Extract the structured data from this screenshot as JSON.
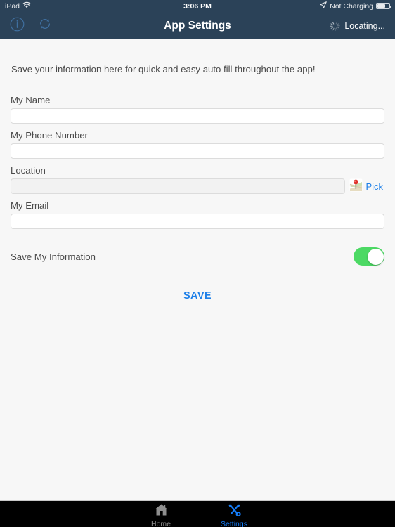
{
  "status_bar": {
    "device": "iPad",
    "wifi_icon": "wifi-icon",
    "time": "3:06 PM",
    "location_arrow_icon": "location-arrow-icon",
    "charging_status": "Not Charging",
    "battery_icon": "battery-icon"
  },
  "nav_bar": {
    "info_icon": "info-circle-icon",
    "refresh_icon": "refresh-icon",
    "title": "App Settings",
    "spinner_icon": "activity-spinner-icon",
    "status_label": "Locating..."
  },
  "content": {
    "intro": "Save your information here for quick and easy auto fill throughout the app!",
    "fields": [
      {
        "label": "My Name",
        "value": "",
        "placeholder": "",
        "readonly": false
      },
      {
        "label": "My Phone Number",
        "value": "",
        "placeholder": "",
        "readonly": false
      },
      {
        "label": "Location",
        "value": "",
        "placeholder": "",
        "readonly": true
      },
      {
        "label": "My Email",
        "value": "",
        "placeholder": "",
        "readonly": false
      }
    ],
    "pick_button": {
      "icon": "map-pin-icon",
      "label": "Pick"
    },
    "toggle": {
      "label": "Save My Information",
      "state": "on"
    },
    "save_label": "SAVE"
  },
  "tab_bar": {
    "items": [
      {
        "label": "Home",
        "icon": "home-icon",
        "active": false
      },
      {
        "label": "Settings",
        "icon": "tools-icon",
        "active": true
      }
    ]
  },
  "colors": {
    "nav_background": "#2b4258",
    "content_background": "#f7f7f7",
    "accent_blue": "#1d7fe8",
    "tab_active_blue": "#157efb",
    "toggle_green": "#4cd964",
    "tab_background": "#000000"
  }
}
